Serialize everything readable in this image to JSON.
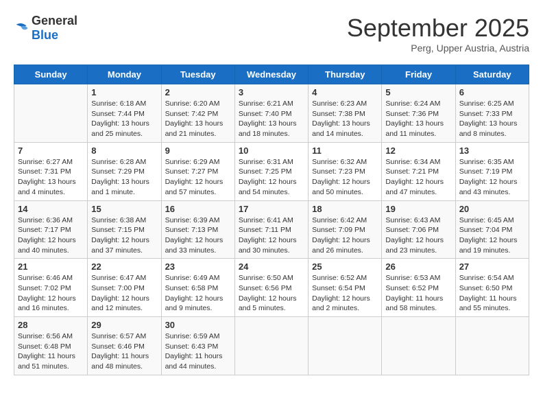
{
  "header": {
    "logo": {
      "general": "General",
      "blue": "Blue"
    },
    "title": "September 2025",
    "subtitle": "Perg, Upper Austria, Austria"
  },
  "weekdays": [
    "Sunday",
    "Monday",
    "Tuesday",
    "Wednesday",
    "Thursday",
    "Friday",
    "Saturday"
  ],
  "weeks": [
    [
      {
        "day": "",
        "info": ""
      },
      {
        "day": "1",
        "info": "Sunrise: 6:18 AM\nSunset: 7:44 PM\nDaylight: 13 hours\nand 25 minutes."
      },
      {
        "day": "2",
        "info": "Sunrise: 6:20 AM\nSunset: 7:42 PM\nDaylight: 13 hours\nand 21 minutes."
      },
      {
        "day": "3",
        "info": "Sunrise: 6:21 AM\nSunset: 7:40 PM\nDaylight: 13 hours\nand 18 minutes."
      },
      {
        "day": "4",
        "info": "Sunrise: 6:23 AM\nSunset: 7:38 PM\nDaylight: 13 hours\nand 14 minutes."
      },
      {
        "day": "5",
        "info": "Sunrise: 6:24 AM\nSunset: 7:36 PM\nDaylight: 13 hours\nand 11 minutes."
      },
      {
        "day": "6",
        "info": "Sunrise: 6:25 AM\nSunset: 7:33 PM\nDaylight: 13 hours\nand 8 minutes."
      }
    ],
    [
      {
        "day": "7",
        "info": "Sunrise: 6:27 AM\nSunset: 7:31 PM\nDaylight: 13 hours\nand 4 minutes."
      },
      {
        "day": "8",
        "info": "Sunrise: 6:28 AM\nSunset: 7:29 PM\nDaylight: 13 hours\nand 1 minute."
      },
      {
        "day": "9",
        "info": "Sunrise: 6:29 AM\nSunset: 7:27 PM\nDaylight: 12 hours\nand 57 minutes."
      },
      {
        "day": "10",
        "info": "Sunrise: 6:31 AM\nSunset: 7:25 PM\nDaylight: 12 hours\nand 54 minutes."
      },
      {
        "day": "11",
        "info": "Sunrise: 6:32 AM\nSunset: 7:23 PM\nDaylight: 12 hours\nand 50 minutes."
      },
      {
        "day": "12",
        "info": "Sunrise: 6:34 AM\nSunset: 7:21 PM\nDaylight: 12 hours\nand 47 minutes."
      },
      {
        "day": "13",
        "info": "Sunrise: 6:35 AM\nSunset: 7:19 PM\nDaylight: 12 hours\nand 43 minutes."
      }
    ],
    [
      {
        "day": "14",
        "info": "Sunrise: 6:36 AM\nSunset: 7:17 PM\nDaylight: 12 hours\nand 40 minutes."
      },
      {
        "day": "15",
        "info": "Sunrise: 6:38 AM\nSunset: 7:15 PM\nDaylight: 12 hours\nand 37 minutes."
      },
      {
        "day": "16",
        "info": "Sunrise: 6:39 AM\nSunset: 7:13 PM\nDaylight: 12 hours\nand 33 minutes."
      },
      {
        "day": "17",
        "info": "Sunrise: 6:41 AM\nSunset: 7:11 PM\nDaylight: 12 hours\nand 30 minutes."
      },
      {
        "day": "18",
        "info": "Sunrise: 6:42 AM\nSunset: 7:09 PM\nDaylight: 12 hours\nand 26 minutes."
      },
      {
        "day": "19",
        "info": "Sunrise: 6:43 AM\nSunset: 7:06 PM\nDaylight: 12 hours\nand 23 minutes."
      },
      {
        "day": "20",
        "info": "Sunrise: 6:45 AM\nSunset: 7:04 PM\nDaylight: 12 hours\nand 19 minutes."
      }
    ],
    [
      {
        "day": "21",
        "info": "Sunrise: 6:46 AM\nSunset: 7:02 PM\nDaylight: 12 hours\nand 16 minutes."
      },
      {
        "day": "22",
        "info": "Sunrise: 6:47 AM\nSunset: 7:00 PM\nDaylight: 12 hours\nand 12 minutes."
      },
      {
        "day": "23",
        "info": "Sunrise: 6:49 AM\nSunset: 6:58 PM\nDaylight: 12 hours\nand 9 minutes."
      },
      {
        "day": "24",
        "info": "Sunrise: 6:50 AM\nSunset: 6:56 PM\nDaylight: 12 hours\nand 5 minutes."
      },
      {
        "day": "25",
        "info": "Sunrise: 6:52 AM\nSunset: 6:54 PM\nDaylight: 12 hours\nand 2 minutes."
      },
      {
        "day": "26",
        "info": "Sunrise: 6:53 AM\nSunset: 6:52 PM\nDaylight: 11 hours\nand 58 minutes."
      },
      {
        "day": "27",
        "info": "Sunrise: 6:54 AM\nSunset: 6:50 PM\nDaylight: 11 hours\nand 55 minutes."
      }
    ],
    [
      {
        "day": "28",
        "info": "Sunrise: 6:56 AM\nSunset: 6:48 PM\nDaylight: 11 hours\nand 51 minutes."
      },
      {
        "day": "29",
        "info": "Sunrise: 6:57 AM\nSunset: 6:46 PM\nDaylight: 11 hours\nand 48 minutes."
      },
      {
        "day": "30",
        "info": "Sunrise: 6:59 AM\nSunset: 6:43 PM\nDaylight: 11 hours\nand 44 minutes."
      },
      {
        "day": "",
        "info": ""
      },
      {
        "day": "",
        "info": ""
      },
      {
        "day": "",
        "info": ""
      },
      {
        "day": "",
        "info": ""
      }
    ]
  ]
}
